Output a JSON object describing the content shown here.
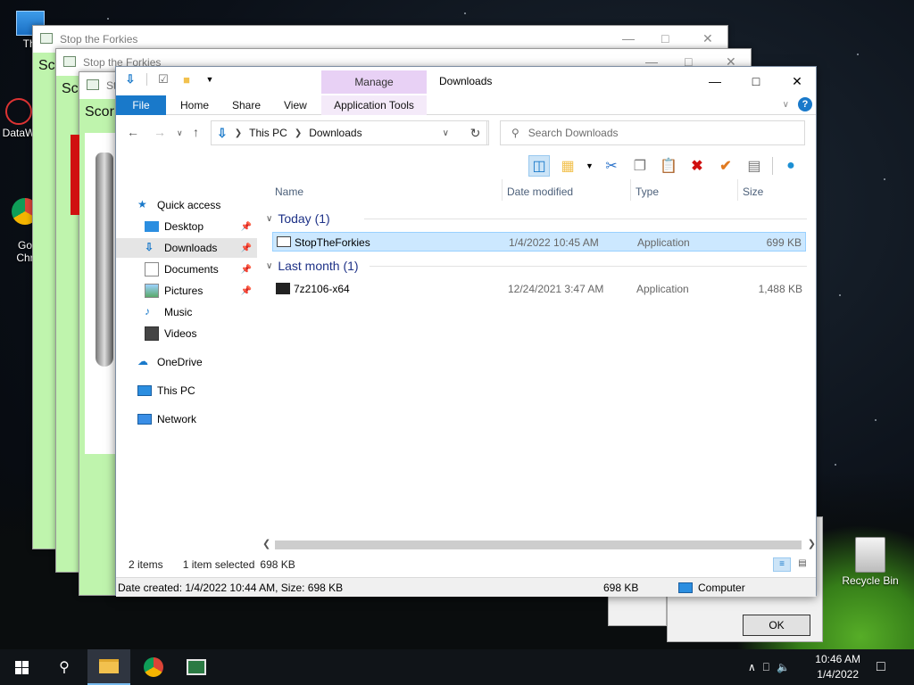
{
  "desktop": {
    "icons": [
      {
        "label": "Thi"
      },
      {
        "label": "DataW"
      },
      {
        "label": "Go\nChr"
      },
      {
        "label": "Recycle Bin"
      }
    ]
  },
  "background_windows": [
    {
      "title": "Stop the Forkies",
      "score_label": "Sco"
    },
    {
      "title": "Stop the Forkies",
      "score_label": "Sc"
    },
    {
      "title": "St",
      "score_label": "Scor"
    }
  ],
  "explorer": {
    "window_title": "Downloads",
    "manage_tab": "Manage",
    "ribbon_tabs": [
      "File",
      "Home",
      "Share",
      "View",
      "Application Tools"
    ],
    "help_label": "?",
    "address": {
      "crumbs": [
        "This PC",
        "Downloads"
      ]
    },
    "search_placeholder": "Search Downloads",
    "nav_pane": [
      {
        "label": "Quick access",
        "icon": "star-icon",
        "pinned": false
      },
      {
        "label": "Desktop",
        "icon": "desktop-folder-icon",
        "pinned": true
      },
      {
        "label": "Downloads",
        "icon": "downloads-folder-icon",
        "pinned": true,
        "selected": true
      },
      {
        "label": "Documents",
        "icon": "documents-folder-icon",
        "pinned": true
      },
      {
        "label": "Pictures",
        "icon": "pictures-folder-icon",
        "pinned": true
      },
      {
        "label": "Music",
        "icon": "music-folder-icon",
        "pinned": false
      },
      {
        "label": "Videos",
        "icon": "videos-folder-icon",
        "pinned": false
      },
      {
        "label": "OneDrive",
        "icon": "cloud-icon",
        "pinned": false
      },
      {
        "label": "This PC",
        "icon": "computer-icon",
        "pinned": false
      },
      {
        "label": "Network",
        "icon": "network-icon",
        "pinned": false
      }
    ],
    "columns": [
      "Name",
      "Date modified",
      "Type",
      "Size"
    ],
    "groups": [
      {
        "label": "Today (1)",
        "files": [
          {
            "name": "StopTheForkies",
            "date": "1/4/2022 10:45 AM",
            "type": "Application",
            "size": "699 KB",
            "selected": true
          }
        ]
      },
      {
        "label": "Last month (1)",
        "files": [
          {
            "name": "7z2106-x64",
            "date": "12/24/2021 3:47 AM",
            "type": "Application",
            "size": "1,488 KB",
            "selected": false
          }
        ]
      }
    ],
    "status": {
      "items": "2 items",
      "selected": "1 item selected",
      "selected_size": "698 KB"
    },
    "details_bar": {
      "info": "Date created: 1/4/2022 10:44 AM, Size: 698 KB",
      "size": "698 KB",
      "location": "Computer"
    }
  },
  "dialog": {
    "ok_label": "OK"
  },
  "taskbar": {
    "time": "10:46 AM",
    "date": "1/4/2022"
  },
  "colors": {
    "accent": "#1979ca",
    "selection": "#cce8ff",
    "manage_tab": "#e8d1f5",
    "game_bg": "#bff4ad"
  }
}
